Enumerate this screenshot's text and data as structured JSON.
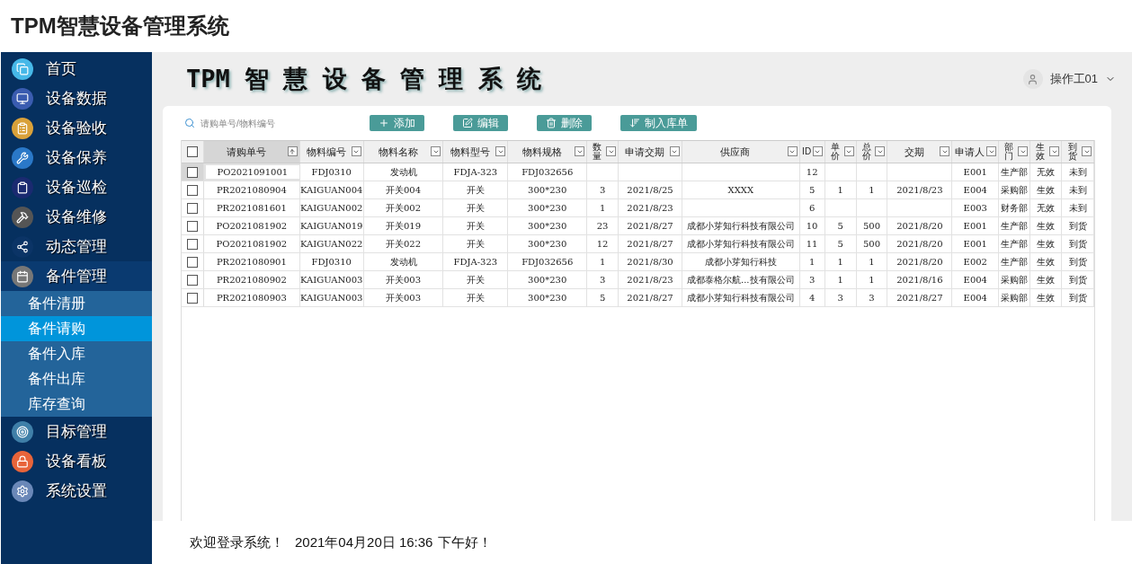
{
  "app_title": "TPM智慧设备管理系统",
  "sidebar": {
    "items": [
      {
        "label": "首页",
        "expanded": false
      },
      {
        "label": "设备数据",
        "expanded": false
      },
      {
        "label": "设备验收",
        "expanded": false
      },
      {
        "label": "设备保养",
        "expanded": false
      },
      {
        "label": "设备巡检",
        "expanded": false
      },
      {
        "label": "设备维修",
        "expanded": false
      },
      {
        "label": "动态管理",
        "expanded": false
      },
      {
        "label": "备件管理",
        "expanded": true,
        "children": [
          {
            "label": "备件清册",
            "selected": false
          },
          {
            "label": "备件请购",
            "selected": true
          },
          {
            "label": "备件入库",
            "selected": false
          },
          {
            "label": "备件出库",
            "selected": false
          },
          {
            "label": "库存查询",
            "selected": false
          }
        ]
      },
      {
        "label": "目标管理",
        "expanded": false
      },
      {
        "label": "设备看板",
        "expanded": false
      },
      {
        "label": "系统设置",
        "expanded": false
      }
    ]
  },
  "header": {
    "title": "TPM 智 慧 设 备 管 理 系 统",
    "user": "操作工01"
  },
  "toolbar": {
    "search": {
      "placeholder": "请购单号/物料编号"
    },
    "buttons": [
      {
        "kind": "add",
        "label": "添加"
      },
      {
        "kind": "edit",
        "label": "编辑"
      },
      {
        "kind": "delete",
        "label": "删除"
      },
      {
        "kind": "export",
        "label": "制入库单"
      }
    ]
  },
  "table": {
    "select_all_checked": false,
    "columns": [
      {
        "label": "请购单号",
        "sorted": true,
        "stacked": false
      },
      {
        "label": "物料编号",
        "sorted": false,
        "stacked": false
      },
      {
        "label": "物料名称",
        "sorted": false,
        "stacked": false
      },
      {
        "label": "物料型号",
        "sorted": false,
        "stacked": false
      },
      {
        "label": "物料规格",
        "sorted": false,
        "stacked": false
      },
      {
        "label": "数量",
        "sorted": false,
        "stacked": true
      },
      {
        "label": "申请交期",
        "sorted": false,
        "stacked": false
      },
      {
        "label": "供应商",
        "sorted": false,
        "stacked": false
      },
      {
        "label": "ID",
        "sorted": false,
        "stacked": true
      },
      {
        "label": "单价",
        "sorted": false,
        "stacked": true
      },
      {
        "label": "总价",
        "sorted": false,
        "stacked": true
      },
      {
        "label": "交期",
        "sorted": false,
        "stacked": false
      },
      {
        "label": "申请人",
        "sorted": false,
        "stacked": false
      },
      {
        "label": "部门",
        "sorted": false,
        "stacked": true
      },
      {
        "label": "生效",
        "sorted": false,
        "stacked": true
      },
      {
        "label": "到货",
        "sorted": false,
        "stacked": true
      }
    ],
    "rows": [
      {
        "selected": true,
        "checked": false,
        "cells": [
          "PO2021091001",
          "FDJ0310",
          "发动机",
          "FDJA-323",
          "FDJ032656",
          "",
          "",
          "",
          "12",
          "",
          "",
          "",
          "E001",
          "生产部",
          "无效",
          "未到"
        ]
      },
      {
        "selected": false,
        "checked": false,
        "cells": [
          "PR2021080904",
          "KAIGUAN004",
          "开关004",
          "开关",
          "300*230",
          "3",
          "2021/8/25",
          "XXXX",
          "5",
          "1",
          "1",
          "2021/8/23",
          "E004",
          "采购部",
          "生效",
          "未到"
        ]
      },
      {
        "selected": false,
        "checked": false,
        "cells": [
          "PR2021081601",
          "KAIGUAN002",
          "开关002",
          "开关",
          "300*230",
          "1",
          "2021/8/23",
          "",
          "6",
          "",
          "",
          "",
          "E003",
          "财务部",
          "无效",
          "未到"
        ]
      },
      {
        "selected": false,
        "checked": false,
        "cells": [
          "PO2021081902",
          "KAIGUAN019",
          "开关019",
          "开关",
          "300*230",
          "23",
          "2021/8/27",
          "成都小芽知行科技有限公司",
          "10",
          "5",
          "500",
          "2021/8/20",
          "E001",
          "生产部",
          "生效",
          "到货"
        ]
      },
      {
        "selected": false,
        "checked": false,
        "cells": [
          "PO2021081902",
          "KAIGUAN022",
          "开关022",
          "开关",
          "300*230",
          "12",
          "2021/8/27",
          "成都小芽知行科技有限公司",
          "11",
          "5",
          "500",
          "2021/8/20",
          "E001",
          "生产部",
          "生效",
          "到货"
        ]
      },
      {
        "selected": false,
        "checked": false,
        "cells": [
          "PR2021080901",
          "FDJ0310",
          "发动机",
          "FDJA-323",
          "FDJ032656",
          "1",
          "2021/8/30",
          "成都小芽知行科技",
          "1",
          "1",
          "1",
          "2021/8/20",
          "E002",
          "生产部",
          "生效",
          "到货"
        ]
      },
      {
        "selected": false,
        "checked": false,
        "cells": [
          "PR2021080902",
          "KAIGUAN003",
          "开关003",
          "开关",
          "300*230",
          "3",
          "2021/8/23",
          "成都泰格尔航...技有限公司",
          "3",
          "1",
          "1",
          "2021/8/16",
          "E004",
          "采购部",
          "生效",
          "到货"
        ]
      },
      {
        "selected": false,
        "checked": false,
        "cells": [
          "PR2021080903",
          "KAIGUAN003",
          "开关003",
          "开关",
          "300*230",
          "5",
          "2021/8/27",
          "成都小芽知行科技有限公司",
          "4",
          "3",
          "3",
          "2021/8/27",
          "E004",
          "采购部",
          "生效",
          "到货"
        ]
      }
    ]
  },
  "footer": {
    "welcome": "欢迎登录系统！",
    "datetime": "2021年04月20日 16:36",
    "greeting": "下午好！"
  }
}
